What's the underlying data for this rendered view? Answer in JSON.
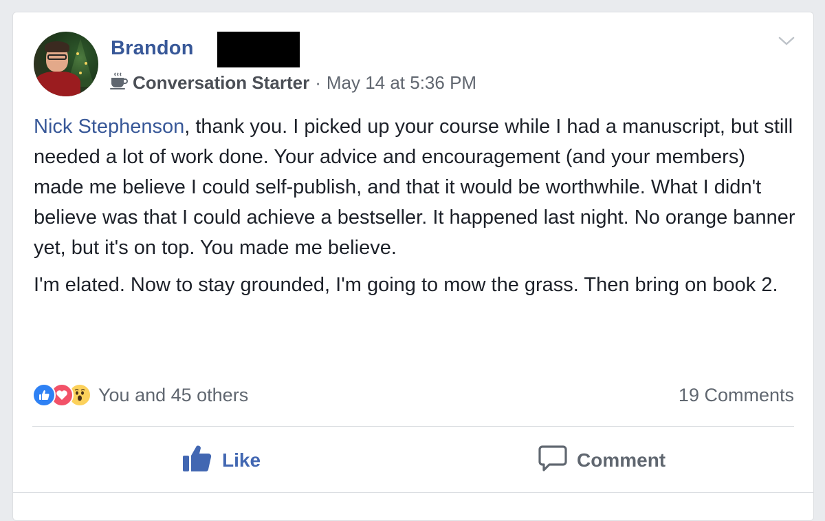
{
  "post": {
    "author_name": "Brandon",
    "badge_icon": "coffee-cup-icon",
    "badge_label": "Conversation Starter",
    "separator": "·",
    "timestamp": "May 14 at 5:36 PM",
    "mention": "Nick Stephenson",
    "paragraph1_rest": ", thank you. I picked up your course while I had a manuscript, but still needed a lot of work done. Your advice and encouragement (and your members) made me believe I could self-publish, and that it would be worthwhile. What I didn't believe was that I could achieve a bestseller. It happened last night. No orange banner yet, but it's on top. You made me believe.",
    "paragraph2": "I'm elated. Now to stay grounded, I'm going to mow the grass. Then bring on book 2."
  },
  "reactions": {
    "icons": [
      "like-reaction-icon",
      "love-reaction-icon",
      "wow-reaction-icon"
    ],
    "summary": "You and 45 others",
    "comments": "19 Comments"
  },
  "actions": {
    "like_label": "Like",
    "comment_label": "Comment"
  },
  "colors": {
    "link": "#385898",
    "like_active": "#4267b2",
    "secondary_text": "#606770",
    "background": "#e9ebee"
  }
}
